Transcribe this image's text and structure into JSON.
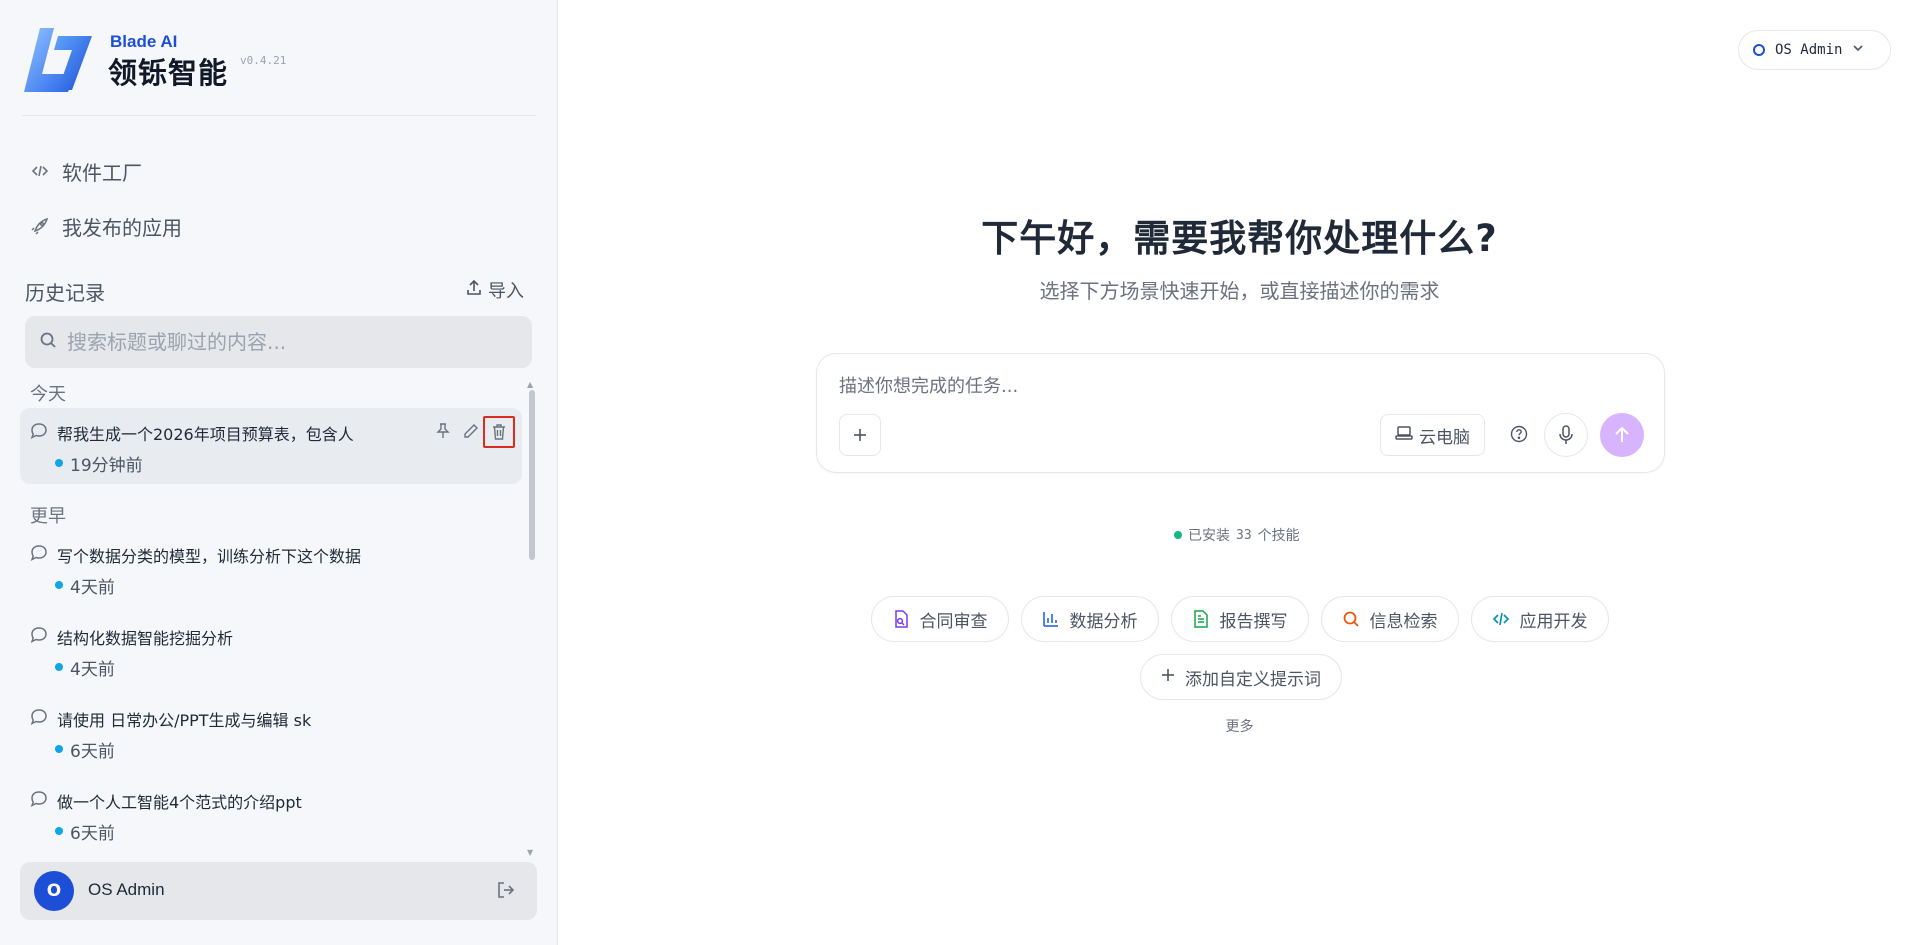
{
  "brand": {
    "en": "Blade AI",
    "cn": "领铄智能",
    "version": "v0.4.21"
  },
  "nav": {
    "software_factory": "软件工厂",
    "my_apps": "我发布的应用"
  },
  "history": {
    "title": "历史记录",
    "import_label": "导入",
    "search_placeholder": "搜索标题或聊过的内容...",
    "today_label": "今天",
    "earlier_label": "更早",
    "today_items": [
      {
        "title": "帮我生成一个2026年项目预算表，包含人",
        "time": "19分钟前"
      }
    ],
    "earlier_items": [
      {
        "title": "写个数据分类的模型，训练分析下这个数据",
        "time": "4天前"
      },
      {
        "title": "结构化数据智能挖掘分析",
        "time": "4天前"
      },
      {
        "title": "请使用 日常办公/PPT生成与编辑 sk",
        "time": "6天前"
      },
      {
        "title": "做一个人工智能4个范式的介绍ppt",
        "time": "6天前"
      }
    ]
  },
  "user": {
    "initial": "O",
    "name": "OS Admin"
  },
  "main": {
    "top_user": "OS Admin",
    "greeting": "下午好，需要我帮你处理什么?",
    "subtitle": "选择下方场景快速开始，或直接描述你的需求",
    "input_placeholder": "描述你想完成的任务...",
    "cloud_pc": "云电脑",
    "skills_prefix": "已安装",
    "skills_count": "33",
    "skills_suffix": "个技能",
    "chips": [
      "合同审查",
      "数据分析",
      "报告撰写",
      "信息检索",
      "应用开发"
    ],
    "add_prompt": "添加自定义提示词",
    "more": "更多"
  },
  "colors": {
    "brand_blue": "#1d4ed8",
    "send_button": "#d8b4fe",
    "time_dot": "#0ea5e9",
    "skills_dot": "#10b981",
    "delete_highlight": "#d92d20"
  }
}
